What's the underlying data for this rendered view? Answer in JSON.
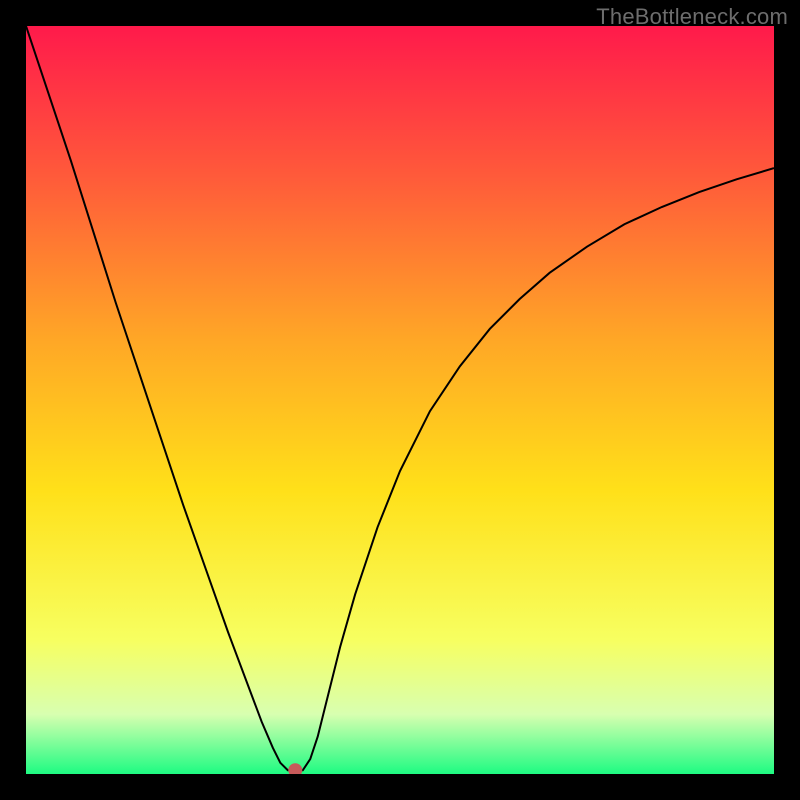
{
  "watermark": "TheBottleneck.com",
  "chart_data": {
    "type": "line",
    "title": "",
    "xlabel": "",
    "ylabel": "",
    "xlim": [
      0,
      100
    ],
    "ylim": [
      0,
      100
    ],
    "grid": false,
    "background_gradient": {
      "direction": "vertical",
      "stops": [
        {
          "pos": 0.0,
          "color": "#ff1a4b"
        },
        {
          "pos": 0.2,
          "color": "#ff5a3a"
        },
        {
          "pos": 0.42,
          "color": "#ffa726"
        },
        {
          "pos": 0.62,
          "color": "#ffe019"
        },
        {
          "pos": 0.82,
          "color": "#f7ff60"
        },
        {
          "pos": 0.92,
          "color": "#d8ffb0"
        },
        {
          "pos": 1.0,
          "color": "#1efb82"
        }
      ]
    },
    "series": [
      {
        "name": "bottleneck-curve",
        "color": "#000000",
        "stroke_width": 2,
        "x": [
          0.0,
          3.0,
          6.0,
          9.0,
          12.0,
          15.0,
          18.0,
          21.0,
          24.0,
          27.0,
          30.0,
          31.5,
          33.0,
          34.0,
          35.0,
          36.0,
          37.0,
          38.0,
          39.0,
          40.0,
          42.0,
          44.0,
          47.0,
          50.0,
          54.0,
          58.0,
          62.0,
          66.0,
          70.0,
          75.0,
          80.0,
          85.0,
          90.0,
          95.0,
          100.0
        ],
        "y": [
          100.0,
          91.0,
          82.0,
          72.5,
          63.0,
          54.0,
          45.0,
          36.0,
          27.5,
          19.0,
          11.0,
          7.0,
          3.5,
          1.5,
          0.5,
          0.5,
          0.5,
          2.0,
          5.0,
          9.0,
          17.0,
          24.0,
          33.0,
          40.5,
          48.5,
          54.5,
          59.5,
          63.5,
          67.0,
          70.5,
          73.5,
          75.8,
          77.8,
          79.5,
          81.0
        ]
      }
    ],
    "marker": {
      "name": "optimal-point",
      "x": 36.0,
      "y": 0.5,
      "color": "#c75a5a",
      "radius_px": 7
    }
  }
}
